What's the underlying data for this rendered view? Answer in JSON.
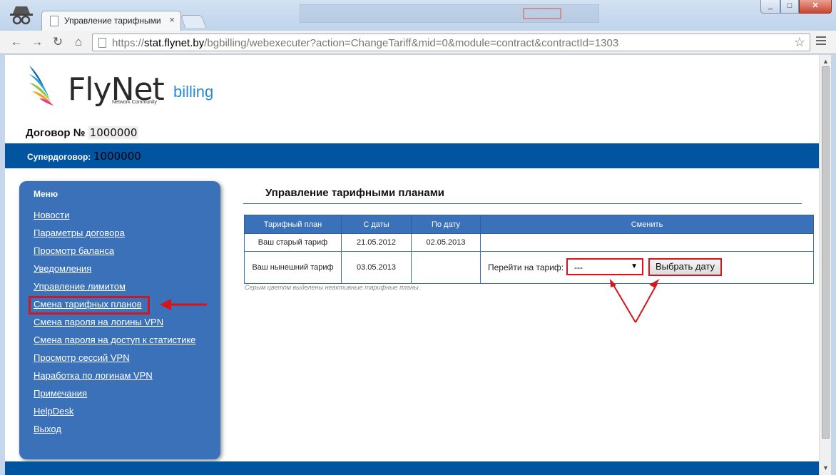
{
  "browser": {
    "tab_title": "Управление тарифными",
    "url_prefix": "https://",
    "url_host": "stat.flynet.by",
    "url_path": "/bgbilling/webexecuter?action=ChangeTariff&mid=0&module=contract&contractId=1303"
  },
  "brand": {
    "name": "FlyNet",
    "product": "billing",
    "tagline": "Network Community",
    "accent_color": "#0054a0"
  },
  "contract": {
    "label": "Договор №",
    "number": "1000000",
    "super_label": "Супердоговор:",
    "super_number": "1000000"
  },
  "sidebar": {
    "title": "Меню",
    "items": [
      {
        "label": "Новости"
      },
      {
        "label": "Параметры договора"
      },
      {
        "label": "Просмотр баланса"
      },
      {
        "label": "Уведомления"
      },
      {
        "label": "Управление лимитом"
      },
      {
        "label": "Смена тарифных планов",
        "highlighted": true
      },
      {
        "label": "Смена пароля на логины VPN"
      },
      {
        "label": "Смена пароля на доступ к статистике"
      },
      {
        "label": "Просмотр сессий VPN"
      },
      {
        "label": "Наработка по логинам VPN"
      },
      {
        "label": "Примечания"
      },
      {
        "label": "HelpDesk"
      },
      {
        "label": "Выход"
      }
    ]
  },
  "main": {
    "title": "Управление тарифными планами",
    "table": {
      "headers": [
        "Тарифный план",
        "С даты",
        "По дату",
        "Сменить"
      ],
      "rows": [
        {
          "plan": "Ваш старый тариф",
          "from": "21.05.2012",
          "to": "02.05.2013"
        },
        {
          "plan": "Ваш нынешний тариф",
          "from": "03.05.2013",
          "to": ""
        }
      ]
    },
    "switch_label": "Перейти на тариф:",
    "select_value": "---",
    "date_button": "Выбрать дату",
    "note": "Серым цветом выделены неактивные тарифные планы."
  }
}
